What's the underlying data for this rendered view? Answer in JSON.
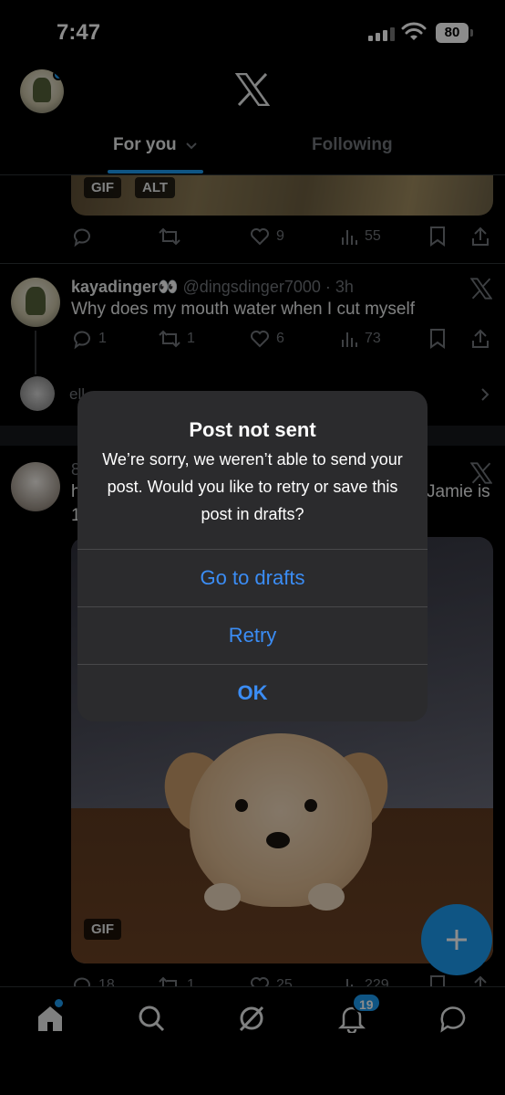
{
  "status_bar": {
    "time": "7:47",
    "battery": "80"
  },
  "header": {
    "tabs": [
      {
        "label": "For you"
      },
      {
        "label": "Following"
      }
    ]
  },
  "feed": {
    "post1": {
      "badges": [
        "GIF",
        "ALT"
      ],
      "replies": "",
      "reposts": "",
      "likes": "9",
      "views": "55"
    },
    "post2": {
      "display_name": "kayadinger👀",
      "handle_time": "@dingsdinger7000 · 3h",
      "text": "Why does my mouth water when I cut myself",
      "replies": "1",
      "reposts": "1",
      "likes": "6",
      "views": "73",
      "reply_preview": "ell"
    },
    "post3": {
      "name_fragment": "8",
      "text_left": "h",
      "text_left2": "1",
      "text_right": "Jamie is",
      "badge": "GIF",
      "replies": "18",
      "reposts": "1",
      "likes": "25",
      "views": "229"
    }
  },
  "bottom_nav": {
    "notifications_count": "19"
  },
  "alert": {
    "title": "Post not sent",
    "message": "We’re sorry, we weren’t able to send your post. Would you like to retry or save this post in drafts?",
    "buttons": [
      "Go to drafts",
      "Retry",
      "OK"
    ]
  },
  "colors": {
    "accent": "#1d9bf0",
    "alert_button": "#3b8df5",
    "background": "#000000"
  }
}
